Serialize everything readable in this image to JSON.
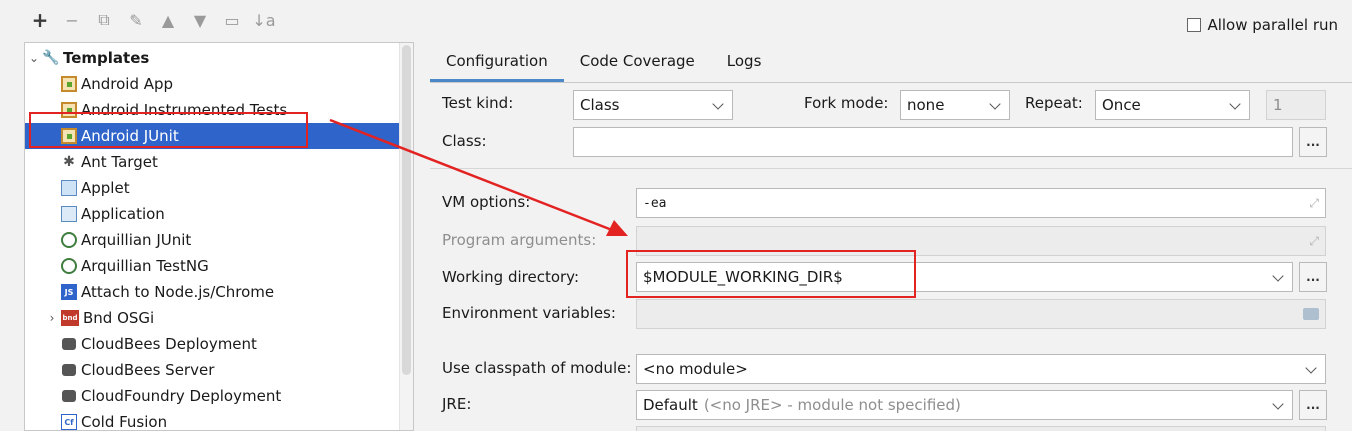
{
  "toolbar": {
    "buttons": [
      {
        "name": "add",
        "glyph": "+"
      },
      {
        "name": "remove",
        "glyph": "−"
      },
      {
        "name": "copy",
        "glyph": "⧉"
      },
      {
        "name": "edit-defaults",
        "glyph": "✎"
      },
      {
        "name": "move-up",
        "glyph": "▲"
      },
      {
        "name": "move-down",
        "glyph": "▼"
      },
      {
        "name": "folder",
        "glyph": "▭"
      },
      {
        "name": "sort",
        "glyph": "↓a"
      }
    ]
  },
  "tree": {
    "root_label": "Templates",
    "items": [
      {
        "label": "Android App",
        "icon": "android-icon"
      },
      {
        "label": "Android Instrumented Tests",
        "icon": "android-icon"
      },
      {
        "label": "Android JUnit",
        "icon": "android-icon",
        "selected": true
      },
      {
        "label": "Ant Target",
        "icon": "ant-icon"
      },
      {
        "label": "Applet",
        "icon": "applet-icon"
      },
      {
        "label": "Application",
        "icon": "application-icon"
      },
      {
        "label": "Arquillian JUnit",
        "icon": "arquillian-icon"
      },
      {
        "label": "Arquillian TestNG",
        "icon": "arquillian-icon"
      },
      {
        "label": "Attach to Node.js/Chrome",
        "icon": "nodejs-icon"
      },
      {
        "label": "Bnd OSGi",
        "icon": "bnd-icon",
        "expandable": true
      },
      {
        "label": "CloudBees Deployment",
        "icon": "cloud-icon"
      },
      {
        "label": "CloudBees Server",
        "icon": "cloud-icon"
      },
      {
        "label": "CloudFoundry Deployment",
        "icon": "cloud-icon"
      },
      {
        "label": "Cold Fusion",
        "icon": "coldfusion-icon"
      }
    ]
  },
  "allow_parallel_run": "Allow parallel run",
  "tabs": [
    {
      "label": "Configuration",
      "active": true
    },
    {
      "label": "Code Coverage"
    },
    {
      "label": "Logs"
    }
  ],
  "form": {
    "test_kind_label": "Test kind:",
    "test_kind_value": "Class",
    "fork_mode_label": "Fork mode:",
    "fork_mode_value": "none",
    "repeat_label": "Repeat:",
    "repeat_value": "Once",
    "repeat_count": "1",
    "class_label": "Class:",
    "class_value": "",
    "vm_options_label": "VM options:",
    "vm_options_value": "-ea",
    "program_args_label": "Program arguments:",
    "working_dir_label": "Working directory:",
    "working_dir_value": "$MODULE_WORKING_DIR$",
    "env_vars_label": "Environment variables:",
    "classpath_label": "Use classpath of module:",
    "classpath_value": "<no module>",
    "jre_label": "JRE:",
    "jre_value": "Default",
    "jre_hint": "(<no JRE> - module not specified)",
    "browse_label": "..."
  },
  "colors": {
    "selection": "#2f65ca",
    "annotation": "#e32222",
    "tab_underline": "#4a88c7"
  }
}
